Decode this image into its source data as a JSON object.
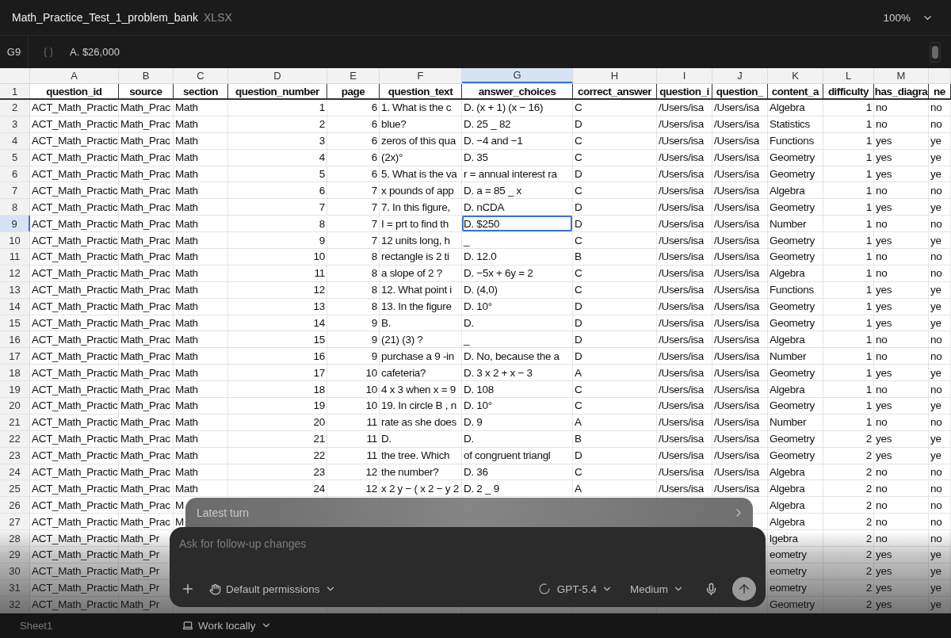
{
  "file": {
    "name": "Math_Practice_Test_1_problem_bank",
    "type": "XLSX"
  },
  "zoom": "100%",
  "formula_bar": {
    "cell_ref": "G9",
    "value": "A. $26,000"
  },
  "sheet": {
    "columns": [
      {
        "letter": "A",
        "kind": "text",
        "selected": false
      },
      {
        "letter": "B",
        "kind": "text",
        "selected": false
      },
      {
        "letter": "C",
        "kind": "text",
        "selected": false
      },
      {
        "letter": "D",
        "kind": "number",
        "selected": false
      },
      {
        "letter": "E",
        "kind": "number",
        "selected": false
      },
      {
        "letter": "F",
        "kind": "text",
        "selected": false
      },
      {
        "letter": "G",
        "kind": "text",
        "selected": true
      },
      {
        "letter": "H",
        "kind": "text",
        "selected": false
      },
      {
        "letter": "I",
        "kind": "text",
        "selected": false
      },
      {
        "letter": "J",
        "kind": "text",
        "selected": false
      },
      {
        "letter": "K",
        "kind": "text",
        "selected": false
      },
      {
        "letter": "L",
        "kind": "number",
        "selected": false
      },
      {
        "letter": "M",
        "kind": "text",
        "selected": false
      },
      {
        "kind": "text",
        "selected": false
      }
    ],
    "rows": [
      {
        "number": "1",
        "kind": "header",
        "selected": false,
        "cells": [
          "question_id",
          "source",
          "section",
          "question_number",
          "page",
          "question_text",
          "answer_choices",
          "correct_answer",
          "question_i",
          "question_",
          "content_a",
          "difficulty",
          "has_diagra",
          "ne"
        ]
      },
      {
        "number": "2",
        "kind": "data",
        "selected": false,
        "cells": [
          "ACT_Math_Practic",
          "Math_Prac",
          "Math",
          "1",
          "6",
          "1. What is the c",
          "D. (x + 1) (x − 16)",
          "C",
          "/Users/isa",
          "/Users/isa",
          "Algebra",
          "1",
          "no",
          "no"
        ]
      },
      {
        "number": "3",
        "kind": "data",
        "selected": false,
        "cells": [
          "ACT_Math_Practic",
          "Math_Prac",
          "Math",
          "2",
          "6",
          "blue?",
          "D. 25 _ 82",
          "D",
          "/Users/isa",
          "/Users/isa",
          "Statistics",
          "1",
          "no",
          "no"
        ]
      },
      {
        "number": "4",
        "kind": "data",
        "selected": false,
        "cells": [
          "ACT_Math_Practic",
          "Math_Prac",
          "Math",
          "3",
          "6",
          "zeros of this qua",
          "D. −4 and −1",
          "C",
          "/Users/isa",
          "/Users/isa",
          "Functions",
          "1",
          "yes",
          "ye"
        ]
      },
      {
        "number": "5",
        "kind": "data",
        "selected": false,
        "cells": [
          "ACT_Math_Practic",
          "Math_Prac",
          "Math",
          "4",
          "6",
          "(2x)°",
          "D. 35",
          "C",
          "/Users/isa",
          "/Users/isa",
          "Geometry",
          "1",
          "yes",
          "ye"
        ]
      },
      {
        "number": "6",
        "kind": "data",
        "selected": false,
        "cells": [
          "ACT_Math_Practic",
          "Math_Prac",
          "Math",
          "5",
          "6",
          "5. What is the va",
          "r = annual interest ra",
          "D",
          "/Users/isa",
          "/Users/isa",
          "Geometry",
          "1",
          "yes",
          "ye"
        ]
      },
      {
        "number": "7",
        "kind": "data",
        "selected": false,
        "cells": [
          "ACT_Math_Practic",
          "Math_Prac",
          "Math",
          "6",
          "7",
          "x pounds of app",
          "D. a = 85 _ x",
          "C",
          "/Users/isa",
          "/Users/isa",
          "Algebra",
          "1",
          "no",
          "no"
        ]
      },
      {
        "number": "8",
        "kind": "data",
        "selected": false,
        "cells": [
          "ACT_Math_Practic",
          "Math_Prac",
          "Math",
          "7",
          "7",
          "7. In this figure,",
          "D. nCDA",
          "D",
          "/Users/isa",
          "/Users/isa",
          "Geometry",
          "1",
          "yes",
          "ye"
        ]
      },
      {
        "number": "9",
        "kind": "data",
        "selected": true,
        "cells": [
          "ACT_Math_Practic",
          "Math_Prac",
          "Math",
          "8",
          "7",
          "I = prt to find th",
          "D. $250",
          "D",
          "/Users/isa",
          "/Users/isa",
          "Number",
          "1",
          "no",
          "no"
        ]
      },
      {
        "number": "10",
        "kind": "data",
        "selected": false,
        "cells": [
          "ACT_Math_Practic",
          "Math_Prac",
          "Math",
          "9",
          "7",
          "12 units long, h",
          "_",
          "C",
          "/Users/isa",
          "/Users/isa",
          "Geometry",
          "1",
          "yes",
          "ye"
        ]
      },
      {
        "number": "11",
        "kind": "data",
        "selected": false,
        "cells": [
          "ACT_Math_Practic",
          "Math_Prac",
          "Math",
          "10",
          "8",
          "rectangle is 2 ti",
          "D. 12.0",
          "B",
          "/Users/isa",
          "/Users/isa",
          "Geometry",
          "1",
          "no",
          "no"
        ]
      },
      {
        "number": "12",
        "kind": "data",
        "selected": false,
        "cells": [
          "ACT_Math_Practic",
          "Math_Prac",
          "Math",
          "11",
          "8",
          "a slope of 2 ?",
          "D. −5x + 6y = 2",
          "C",
          "/Users/isa",
          "/Users/isa",
          "Algebra",
          "1",
          "no",
          "no"
        ]
      },
      {
        "number": "13",
        "kind": "data",
        "selected": false,
        "cells": [
          "ACT_Math_Practic",
          "Math_Prac",
          "Math",
          "12",
          "8",
          "12. What point i",
          "D. (4,0)",
          "C",
          "/Users/isa",
          "/Users/isa",
          "Functions",
          "1",
          "yes",
          "ye"
        ]
      },
      {
        "number": "14",
        "kind": "data",
        "selected": false,
        "cells": [
          "ACT_Math_Practic",
          "Math_Prac",
          "Math",
          "13",
          "8",
          "13. In the figure",
          "D. 10°",
          "D",
          "/Users/isa",
          "/Users/isa",
          "Geometry",
          "1",
          "yes",
          "ye"
        ]
      },
      {
        "number": "15",
        "kind": "data",
        "selected": false,
        "cells": [
          "ACT_Math_Practic",
          "Math_Prac",
          "Math",
          "14",
          "9",
          "B.",
          "D.",
          "D",
          "/Users/isa",
          "/Users/isa",
          "Geometry",
          "1",
          "yes",
          "ye"
        ]
      },
      {
        "number": "16",
        "kind": "data",
        "selected": false,
        "cells": [
          "ACT_Math_Practic",
          "Math_Prac",
          "Math",
          "15",
          "9",
          "(21) (3) ?",
          "_",
          "D",
          "/Users/isa",
          "/Users/isa",
          "Algebra",
          "1",
          "no",
          "no"
        ]
      },
      {
        "number": "17",
        "kind": "data",
        "selected": false,
        "cells": [
          "ACT_Math_Practic",
          "Math_Prac",
          "Math",
          "16",
          "9",
          "purchase a 9 -in",
          "D. No, because the a",
          "D",
          "/Users/isa",
          "/Users/isa",
          "Number",
          "1",
          "no",
          "no"
        ]
      },
      {
        "number": "18",
        "kind": "data",
        "selected": false,
        "cells": [
          "ACT_Math_Practic",
          "Math_Prac",
          "Math",
          "17",
          "10",
          "cafeteria?",
          "D. 3 x 2 + x − 3",
          "A",
          "/Users/isa",
          "/Users/isa",
          "Geometry",
          "1",
          "yes",
          "ye"
        ]
      },
      {
        "number": "19",
        "kind": "data",
        "selected": false,
        "cells": [
          "ACT_Math_Practic",
          "Math_Prac",
          "Math",
          "18",
          "10",
          "4 x 3 when x = 9",
          "D. 108",
          "C",
          "/Users/isa",
          "/Users/isa",
          "Algebra",
          "1",
          "no",
          "no"
        ]
      },
      {
        "number": "20",
        "kind": "data",
        "selected": false,
        "cells": [
          "ACT_Math_Practic",
          "Math_Prac",
          "Math",
          "19",
          "10",
          "19. In circle B , n",
          "D. 10°",
          "C",
          "/Users/isa",
          "/Users/isa",
          "Geometry",
          "1",
          "yes",
          "ye"
        ]
      },
      {
        "number": "21",
        "kind": "data",
        "selected": false,
        "cells": [
          "ACT_Math_Practic",
          "Math_Prac",
          "Math",
          "20",
          "11",
          "rate as she does",
          "D. 9",
          "A",
          "/Users/isa",
          "/Users/isa",
          "Number",
          "1",
          "no",
          "no"
        ]
      },
      {
        "number": "22",
        "kind": "data",
        "selected": false,
        "cells": [
          "ACT_Math_Practic",
          "Math_Prac",
          "Math",
          "21",
          "11",
          "D.",
          "D.",
          "B",
          "/Users/isa",
          "/Users/isa",
          "Geometry",
          "2",
          "yes",
          "ye"
        ]
      },
      {
        "number": "23",
        "kind": "data",
        "selected": false,
        "cells": [
          "ACT_Math_Practic",
          "Math_Prac",
          "Math",
          "22",
          "11",
          "the tree. Which",
          "of congruent triangl",
          "D",
          "/Users/isa",
          "/Users/isa",
          "Geometry",
          "2",
          "yes",
          "ye"
        ]
      },
      {
        "number": "24",
        "kind": "data",
        "selected": false,
        "cells": [
          "ACT_Math_Practic",
          "Math_Prac",
          "Math",
          "23",
          "12",
          "the number?",
          "D. 36",
          "C",
          "/Users/isa",
          "/Users/isa",
          "Algebra",
          "2",
          "no",
          "no"
        ]
      },
      {
        "number": "25",
        "kind": "data",
        "selected": false,
        "cells": [
          "ACT_Math_Practic",
          "Math_Prac",
          "Math",
          "24",
          "12",
          "x 2 y − ( x 2 − y 2",
          "D. 2 _ 9",
          "A",
          "/Users/isa",
          "/Users/isa",
          "Algebra",
          "2",
          "no",
          "no"
        ]
      },
      {
        "number": "26",
        "kind": "data",
        "selected": false,
        "cells": [
          "ACT_Math_Practic",
          "Math_Prac",
          "M",
          null,
          null,
          null,
          null,
          null,
          null,
          null,
          "Algebra",
          "2",
          "no",
          "no"
        ]
      },
      {
        "number": "27",
        "kind": "data",
        "selected": false,
        "cells": [
          "ACT_Math_Practic",
          "Math_Prac",
          "M",
          null,
          null,
          null,
          null,
          null,
          null,
          null,
          "Algebra",
          "2",
          "no",
          "no"
        ]
      },
      {
        "number": "28",
        "kind": "data",
        "selected": false,
        "cells": [
          "ACT_Math_Practic",
          "Math_Pr",
          null,
          null,
          null,
          null,
          null,
          null,
          null,
          null,
          "lgebra",
          "2",
          "no",
          "no"
        ]
      },
      {
        "number": "29",
        "kind": "data",
        "selected": false,
        "cells": [
          "ACT_Math_Practic",
          "Math_Pr",
          null,
          null,
          null,
          null,
          null,
          null,
          null,
          null,
          "eometry",
          "2",
          "yes",
          "ye"
        ]
      },
      {
        "number": "30",
        "kind": "data",
        "selected": false,
        "cells": [
          "ACT_Math_Practic",
          "Math_Pr",
          null,
          null,
          null,
          null,
          null,
          null,
          null,
          null,
          "eometry",
          "2",
          "yes",
          "ye"
        ]
      },
      {
        "number": "31",
        "kind": "data",
        "selected": false,
        "cells": [
          "ACT_Math_Practic",
          "Math_Pr",
          null,
          null,
          null,
          null,
          null,
          null,
          null,
          null,
          "eometry",
          "2",
          "yes",
          "ye"
        ]
      },
      {
        "number": "32",
        "kind": "data",
        "selected": false,
        "cells": [
          "ACT_Math_Practic",
          "Math_Pr",
          null,
          null,
          null,
          null,
          null,
          null,
          null,
          null,
          "Geometry",
          "2",
          "yes",
          "ye"
        ]
      }
    ]
  },
  "assistant": {
    "latest_turn": "Latest turn",
    "placeholder": "Ask for follow-up changes",
    "permissions": "Default permissions",
    "model": "GPT-5.4",
    "effort": "Medium"
  },
  "bottom_bar": {
    "sheet_tab": "Sheet1",
    "workspace": "Work locally"
  }
}
